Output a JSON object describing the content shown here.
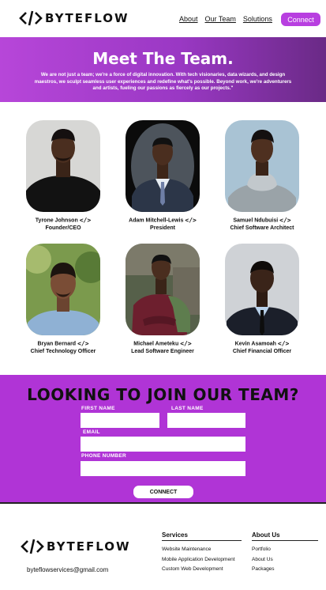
{
  "header": {
    "brand": "BYTEFLOW",
    "nav": [
      "About",
      "Our Team",
      "Solutions"
    ],
    "connect_label": "Connect"
  },
  "hero": {
    "title": "Meet The Team.",
    "text": "We are not just a team; we're a force of digital innovation. With tech visionaries, data wizards, and design maestros, we sculpt seamless user experiences and redefine what's possible. Beyond work, we're adventurers and artists, fueling our passions as fiercely as our projects.\""
  },
  "team": [
    {
      "name": "Tyrone Johnson",
      "role": "Founder/CEO"
    },
    {
      "name": "Adam Mitchell-Lewis",
      "role": "President"
    },
    {
      "name": "Samuel Ndubuisi",
      "role": "Chief Software Architect"
    },
    {
      "name": "Bryan Bernard",
      "role": "Chief Technology Officer"
    },
    {
      "name": "Michael Ameteku",
      "role": "Lead Software Engineer"
    },
    {
      "name": "Kevin Asamoah",
      "role": "Chief Financial Officer"
    }
  ],
  "join": {
    "title": "LOOKING TO JOIN OUR TEAM?",
    "first_name_label": "FIRST NAME",
    "last_name_label": "LAST NAME",
    "email_label": "EMAIL",
    "phone_label": "PHONE NUMBER",
    "submit_label": "CONNECT"
  },
  "footer": {
    "brand": "BYTEFLOW",
    "email": "byteflowservices@gmail.com",
    "services_title": "Services",
    "services": [
      "Website Maintenance",
      "Mobile Application Development",
      "Custom Web Development"
    ],
    "about_title": "About Us",
    "about": [
      "Portfolio",
      "About Us",
      "Packages"
    ]
  },
  "colors": {
    "accent": "#b83fe0",
    "join_bg": "#b034d6",
    "hero_start": "#b746d9",
    "hero_end": "#6a2a86"
  }
}
